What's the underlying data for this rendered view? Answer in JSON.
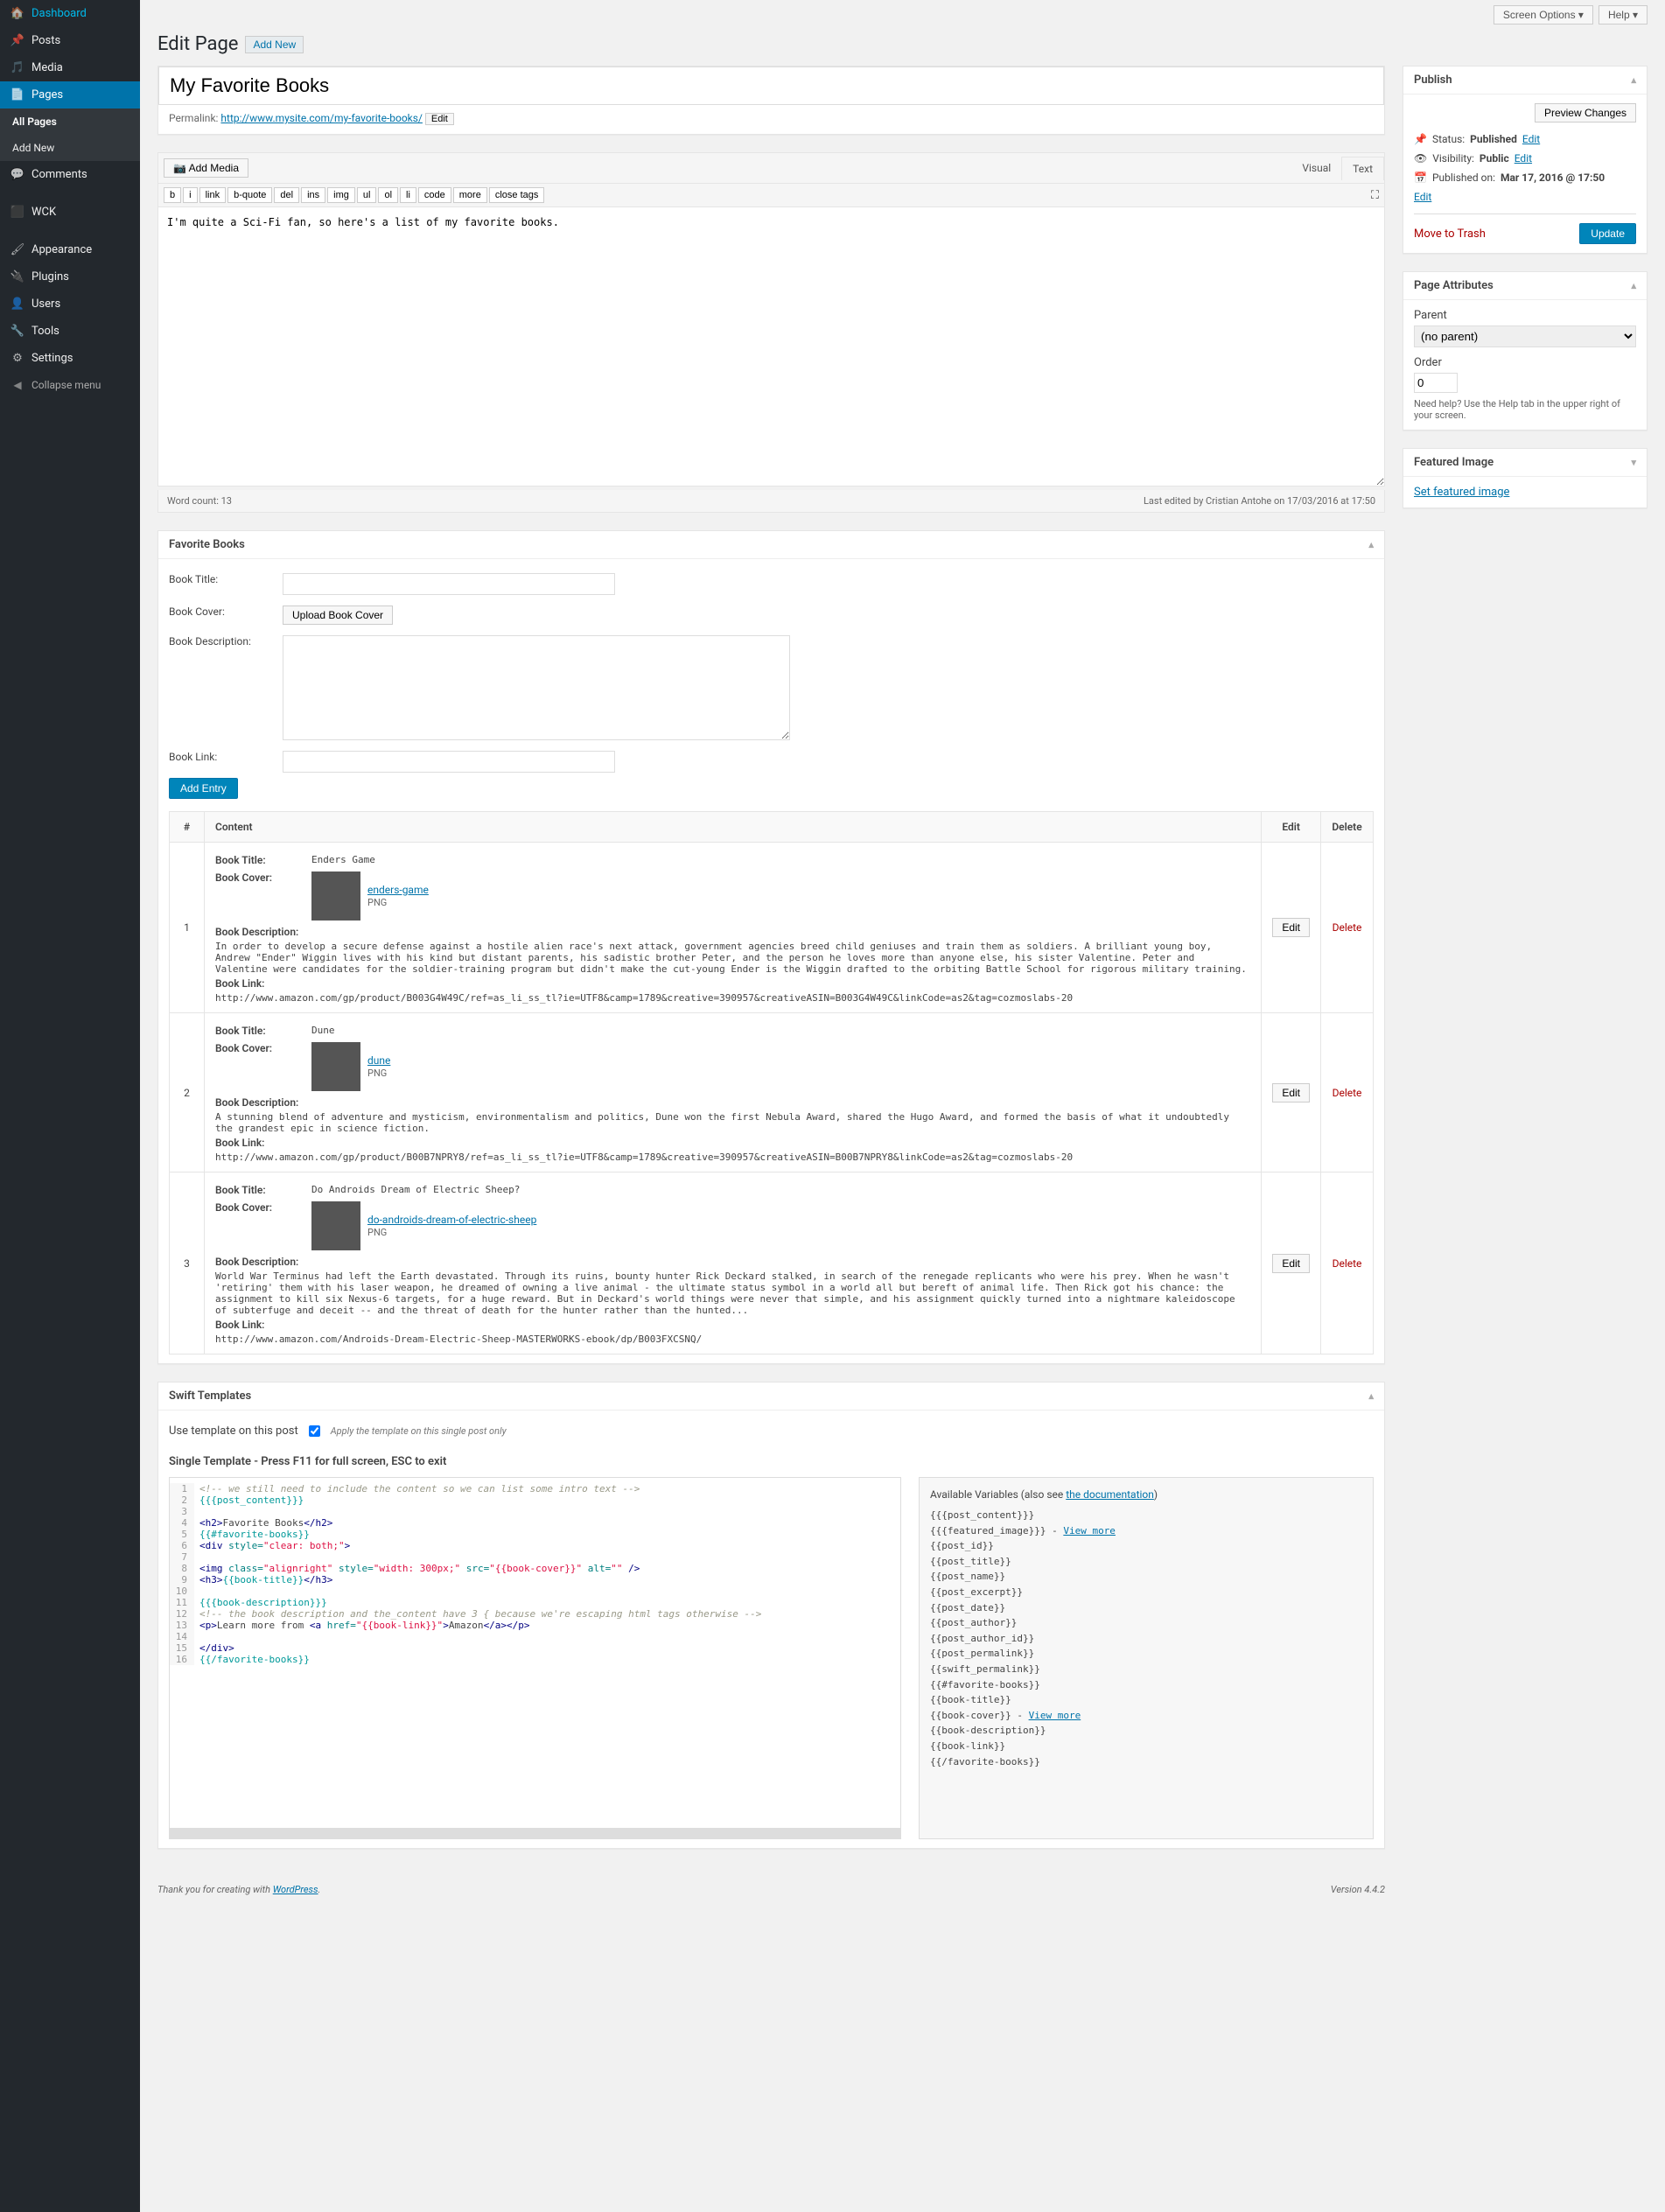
{
  "sidebar": {
    "items": [
      {
        "icon": "dashboard",
        "label": "Dashboard"
      },
      {
        "icon": "pin",
        "label": "Posts"
      },
      {
        "icon": "media",
        "label": "Media"
      },
      {
        "icon": "page",
        "label": "Pages",
        "active": true
      },
      {
        "icon": "comment",
        "label": "Comments"
      },
      {
        "icon": "wck",
        "label": "WCK"
      },
      {
        "icon": "appearance",
        "label": "Appearance"
      },
      {
        "icon": "plugin",
        "label": "Plugins"
      },
      {
        "icon": "user",
        "label": "Users"
      },
      {
        "icon": "tool",
        "label": "Tools"
      },
      {
        "icon": "settings",
        "label": "Settings"
      }
    ],
    "sub": [
      {
        "label": "All Pages",
        "current": true
      },
      {
        "label": "Add New"
      }
    ],
    "collapse": "Collapse menu"
  },
  "topbar": {
    "screen_options": "Screen Options",
    "help": "Help"
  },
  "head": {
    "title": "Edit Page",
    "addnew": "Add New"
  },
  "title": "My Favorite Books",
  "permalink": {
    "label": "Permalink:",
    "url": "http://www.mysite.com/my-favorite-books/",
    "edit": "Edit"
  },
  "media_btn": "Add Media",
  "tabs": {
    "visual": "Visual",
    "text": "Text"
  },
  "qt": [
    "b",
    "i",
    "link",
    "b-quote",
    "del",
    "ins",
    "img",
    "ul",
    "ol",
    "li",
    "code",
    "more",
    "close tags"
  ],
  "content": "I'm quite a Sci-Fi fan, so here's a list of my favorite books.",
  "wordcount": {
    "label": "Word count: 13",
    "lastedit": "Last edited by Cristian Antohe on 17/03/2016 at 17:50"
  },
  "favbox": {
    "title": "Favorite Books",
    "fields": {
      "title": "Book Title:",
      "cover": "Book Cover:",
      "desc": "Book Description:",
      "link": "Book Link:"
    },
    "upload": "Upload Book Cover",
    "add": "Add Entry"
  },
  "table": {
    "headers": {
      "num": "#",
      "content": "Content",
      "edit": "Edit",
      "delete": "Delete"
    },
    "edit": "Edit",
    "delete": "Delete",
    "rows": [
      {
        "n": "1",
        "title": "Enders Game",
        "cover_link": "enders-game",
        "cover_ext": "PNG",
        "desc": "In order to develop a secure defense against a hostile alien race's next attack, government agencies breed child geniuses and train them as soldiers. A brilliant young boy, Andrew \"Ender\" Wiggin lives with his kind but distant parents, his sadistic brother Peter, and the person he loves more than anyone else, his sister Valentine. Peter and Valentine were candidates for the soldier-training program but didn't make the cut-young Ender is the Wiggin drafted to the orbiting Battle School for rigorous military training.",
        "link": "http://www.amazon.com/gp/product/B003G4W49C/ref=as_li_ss_tl?ie=UTF8&camp=1789&creative=390957&creativeASIN=B003G4W49C&linkCode=as2&tag=cozmoslabs-20"
      },
      {
        "n": "2",
        "title": "Dune",
        "cover_link": "dune",
        "cover_ext": "PNG",
        "desc": "A stunning blend of adventure and mysticism, environmentalism and politics, Dune won the first Nebula Award, shared the Hugo Award, and formed the basis of what it undoubtedly the grandest epic in science fiction.",
        "link": "http://www.amazon.com/gp/product/B00B7NPRY8/ref=as_li_ss_tl?ie=UTF8&camp=1789&creative=390957&creativeASIN=B00B7NPRY8&linkCode=as2&tag=cozmoslabs-20"
      },
      {
        "n": "3",
        "title": "Do Androids Dream of Electric Sheep?",
        "cover_link": "do-androids-dream-of-electric-sheep",
        "cover_ext": "PNG",
        "desc": "World War Terminus had left the Earth devastated. Through its ruins, bounty hunter Rick Deckard stalked, in search of the renegade replicants who were his prey. When he wasn't 'retiring' them with his laser weapon, he dreamed of owning a live animal - the ultimate status symbol in a world all but bereft of animal life. Then Rick got his chance: the assignment to kill six Nexus-6 targets, for a huge reward. But in Deckard's world things were never that simple, and his assignment quickly turned into a nightmare kaleidoscope of subterfuge and deceit -- and the threat of death for the hunter rather than the hunted...",
        "link": "http://www.amazon.com/Androids-Dream-Electric-Sheep-MASTERWORKS-ebook/dp/B003FXCSNQ/"
      }
    ]
  },
  "swift": {
    "title": "Swift Templates",
    "use": "Use template on this post",
    "hint": "Apply the template on this single post only",
    "single_title": "Single Template - Press F11 for full screen, ESC to exit",
    "vars_title": "Available Variables (also see ",
    "vars_link": "the documentation",
    "view_more": "View more",
    "vars": [
      "{{{post_content}}}",
      "{{{featured_image}}}",
      "{{post_id}}",
      "{{post_title}}",
      "{{post_name}}",
      "{{post_excerpt}}",
      "{{post_date}}",
      "{{post_author}}",
      "{{post_author_id}}",
      "{{post_permalink}}",
      "{{swift_permalink}}",
      "{{#favorite-books}}",
      "  {{book-title}}",
      "  {{book-cover}}",
      "  {{book-description}}",
      "  {{book-link}}",
      "{{/favorite-books}}"
    ]
  },
  "publish": {
    "title": "Publish",
    "preview": "Preview Changes",
    "status_lbl": "Status:",
    "status_val": "Published",
    "edit": "Edit",
    "vis_lbl": "Visibility:",
    "vis_val": "Public",
    "pub_lbl": "Published on:",
    "pub_val": "Mar 17, 2016 @ 17:50",
    "trash": "Move to Trash",
    "update": "Update"
  },
  "attrs": {
    "title": "Page Attributes",
    "parent": "Parent",
    "noparent": "(no parent)",
    "order": "Order",
    "orderval": "0",
    "help": "Need help? Use the Help tab in the upper right of your screen."
  },
  "featured": {
    "title": "Featured Image",
    "set": "Set featured image"
  },
  "footer": {
    "thank": "Thank you for creating with ",
    "wp": "WordPress",
    "ver": "Version 4.4.2"
  }
}
